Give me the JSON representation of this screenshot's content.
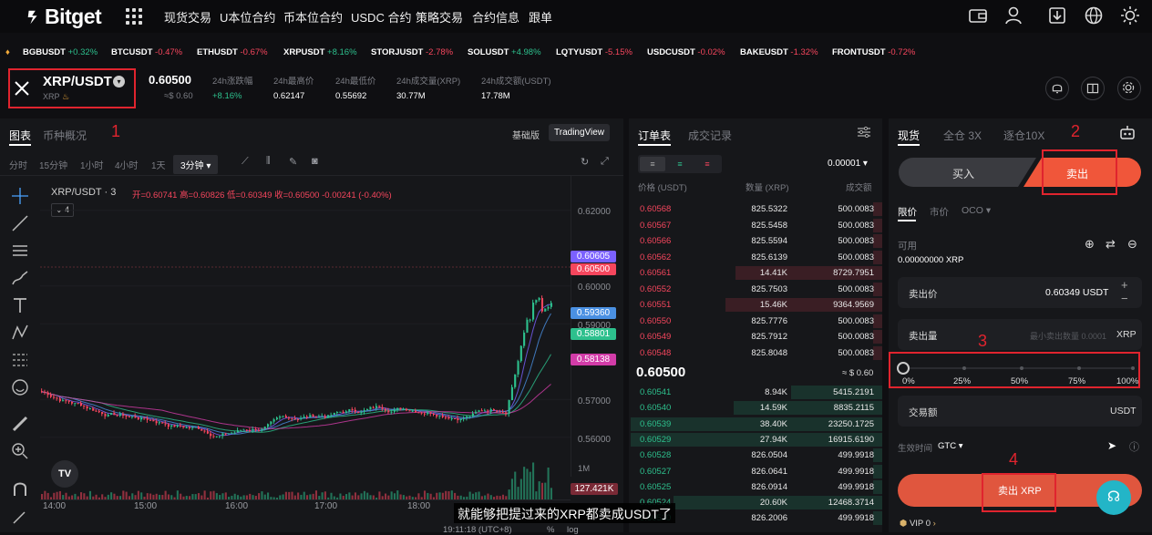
{
  "nav": {
    "logo": "Bitget",
    "items": [
      "现货交易",
      "U本位合约",
      "币本位合约",
      "USDC 合约",
      "策略交易",
      "合约信息",
      "跟单"
    ]
  },
  "ticker": [
    {
      "sym": "BGBUSDT",
      "chg": "+0.32%",
      "dir": "up"
    },
    {
      "sym": "BTCUSDT",
      "chg": "-0.47%",
      "dir": "dn"
    },
    {
      "sym": "ETHUSDT",
      "chg": "-0.67%",
      "dir": "dn"
    },
    {
      "sym": "XRPUSDT",
      "chg": "+8.16%",
      "dir": "up"
    },
    {
      "sym": "STORJUSDT",
      "chg": "-2.78%",
      "dir": "dn"
    },
    {
      "sym": "SOLUSDT",
      "chg": "+4.98%",
      "dir": "up"
    },
    {
      "sym": "LQTYUSDT",
      "chg": "-5.15%",
      "dir": "dn"
    },
    {
      "sym": "USDCUSDT",
      "chg": "-0.02%",
      "dir": "dn"
    },
    {
      "sym": "BAKEUSDT",
      "chg": "-1.32%",
      "dir": "dn"
    },
    {
      "sym": "FRONTUSDT",
      "chg": "-0.72%",
      "dir": "dn"
    }
  ],
  "pair": {
    "name": "XRP/USDT",
    "base": "XRP",
    "price": "0.60500",
    "price_usd": "≈$ 0.60",
    "stats": [
      {
        "label": "24h涨跌幅",
        "value": "+8.16%",
        "up": true
      },
      {
        "label": "24h最高价",
        "value": "0.62147"
      },
      {
        "label": "24h最低价",
        "value": "0.55692"
      },
      {
        "label": "24h成交量(XRP)",
        "value": "30.77M"
      },
      {
        "label": "24h成交额(USDT)",
        "value": "17.78M"
      }
    ]
  },
  "annotations": [
    "1",
    "2",
    "3",
    "4"
  ],
  "chart": {
    "tabs": [
      "图表",
      "币种概况"
    ],
    "mode_basic": "基础版",
    "mode_tv": "TradingView",
    "intervals": [
      "分时",
      "15分钟",
      "1小时",
      "4小时",
      "1天"
    ],
    "interval_active": "3分钟",
    "legend_symbol": "XRP/USDT · 3",
    "ohlc": "开=0.60741 高=0.60826 低=0.60349 收=0.60500 -0.00241 (-0.40%)",
    "indicator_count": "4",
    "y_labels": [
      "0.62000",
      "0.60000",
      "0.59000",
      "0.57000",
      "0.56000"
    ],
    "price_tags": [
      {
        "value": "0.60605",
        "color": "#7b61ff"
      },
      {
        "value": "0.60500",
        "color": "#f6465d"
      },
      {
        "value": "0.59360",
        "color": "#4a90e2"
      },
      {
        "value": "0.58801",
        "color": "#2dc08d"
      },
      {
        "value": "0.58138",
        "color": "#d23ca8"
      }
    ],
    "volume_label": "1M",
    "volume_tag": "127.421K",
    "x_labels": [
      "14:00",
      "15:00",
      "16:00",
      "17:00",
      "18:00"
    ],
    "time_bottom": "19:11:18 (UTC+8)",
    "pct": "%",
    "log": "log"
  },
  "orderbook": {
    "tabs": [
      "订单表",
      "成交记录"
    ],
    "precision": "0.00001",
    "headers": [
      "价格 (USDT)",
      "数量 (XRP)",
      "成交额"
    ],
    "asks": [
      [
        "0.60568",
        "825.5322",
        "500.0083"
      ],
      [
        "0.60567",
        "825.5458",
        "500.0083"
      ],
      [
        "0.60566",
        "825.5594",
        "500.0083"
      ],
      [
        "0.60562",
        "825.6139",
        "500.0083"
      ],
      [
        "0.60561",
        "14.41K",
        "8729.7951"
      ],
      [
        "0.60552",
        "825.7503",
        "500.0083"
      ],
      [
        "0.60551",
        "15.46K",
        "9364.9569"
      ],
      [
        "0.60550",
        "825.7776",
        "500.0083"
      ],
      [
        "0.60549",
        "825.7912",
        "500.0083"
      ],
      [
        "0.60548",
        "825.8048",
        "500.0083"
      ]
    ],
    "mid_price": "0.60500",
    "mid_usd": "≈ $ 0.60",
    "bids": [
      [
        "0.60541",
        "8.94K",
        "5415.2191"
      ],
      [
        "0.60540",
        "14.59K",
        "8835.2115"
      ],
      [
        "0.60539",
        "38.40K",
        "23250.1725"
      ],
      [
        "0.60529",
        "27.94K",
        "16915.6190"
      ],
      [
        "0.60528",
        "826.0504",
        "499.9918"
      ],
      [
        "0.60527",
        "826.0641",
        "499.9918"
      ],
      [
        "0.60525",
        "826.0914",
        "499.9918"
      ],
      [
        "0.60524",
        "20.60K",
        "12468.3714"
      ],
      [
        "0.60520",
        "826.2006",
        "499.9918"
      ]
    ]
  },
  "trade": {
    "tabs": [
      "现货",
      "全仓 3X",
      "逐仓10X"
    ],
    "buy": "买入",
    "sell": "卖出",
    "order_types": [
      "限价",
      "市价",
      "OCO"
    ],
    "available_label": "可用",
    "available_value": "0.00000000 XRP",
    "sell_price_label": "卖出价",
    "sell_price_value": "0.60349 USDT",
    "sell_qty_label": "卖出量",
    "sell_qty_placeholder": "最小卖出数量 0.0001",
    "sell_qty_unit": "XRP",
    "slider_marks": [
      "0%",
      "25%",
      "50%",
      "75%",
      "100%"
    ],
    "amount_label": "交易额",
    "amount_unit": "USDT",
    "tif_label": "生效时间",
    "tif_value": "GTC",
    "submit": "卖出 XRP",
    "vip": "VIP 0"
  },
  "subtitle": "就能够把提过来的XRP都卖成USDT了"
}
